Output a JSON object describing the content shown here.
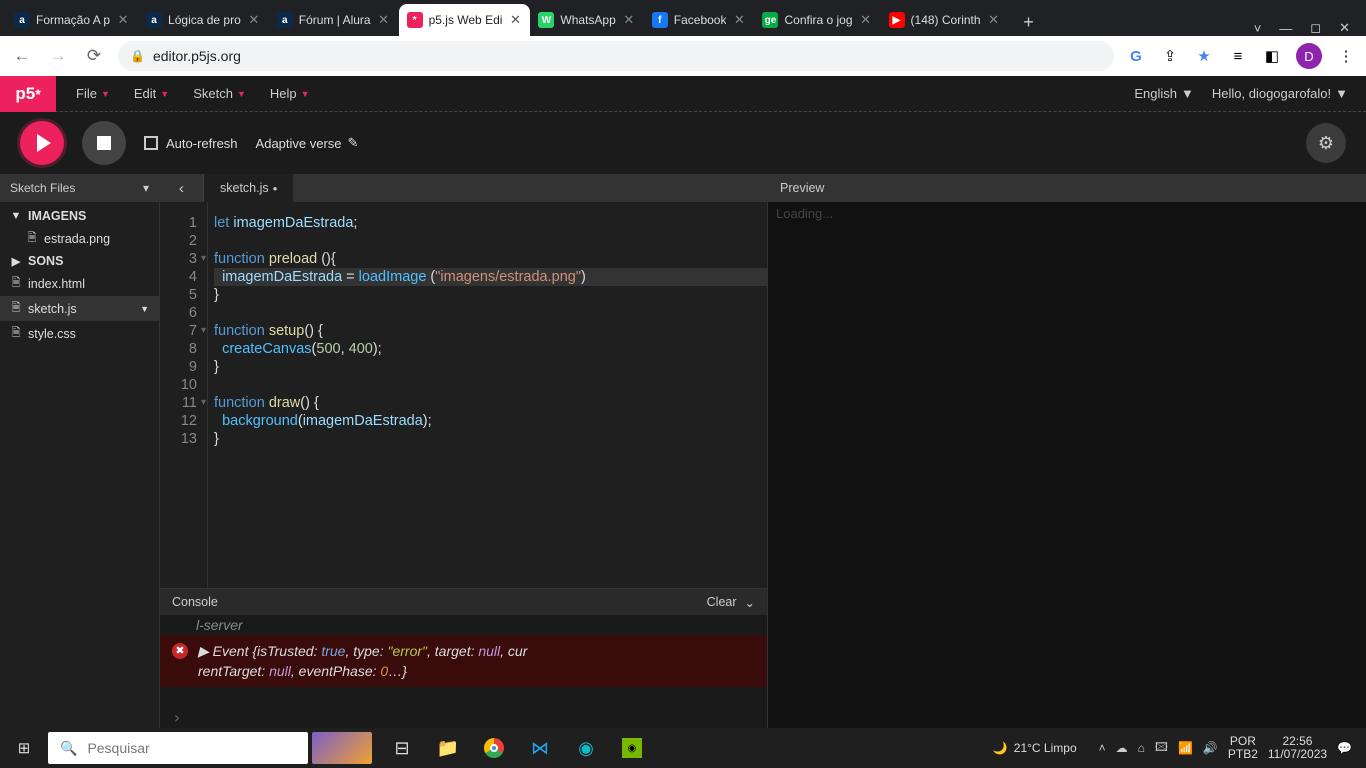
{
  "browser": {
    "tabs": [
      {
        "fav": "a",
        "favbg": "#0b2a4a",
        "label": "Formação A p"
      },
      {
        "fav": "a",
        "favbg": "#0b2a4a",
        "label": "Lógica de pro"
      },
      {
        "fav": "a",
        "favbg": "#0b2a4a",
        "label": "Fórum | Alura"
      },
      {
        "fav": "*",
        "favbg": "#ed225d",
        "label": "p5.js Web Edi",
        "active": true
      },
      {
        "fav": "W",
        "favbg": "#25d366",
        "label": "WhatsApp"
      },
      {
        "fav": "f",
        "favbg": "#1877f2",
        "label": "Facebook"
      },
      {
        "fav": "ge",
        "favbg": "#06aa48",
        "label": "Confira o jog"
      },
      {
        "fav": "▶",
        "favbg": "#ff0000",
        "label": "(148) Corinth"
      }
    ],
    "url": "editor.p5js.org",
    "avatar": "D"
  },
  "p5": {
    "menus": [
      "File",
      "Edit",
      "Sketch",
      "Help"
    ],
    "lang": "English",
    "user_label": "Hello, diogogarofalo!",
    "auto_refresh": "Auto-refresh",
    "sketch_name": "Adaptive verse",
    "sidebar_title": "Sketch Files",
    "files": [
      {
        "type": "folder",
        "open": true,
        "label": "IMAGENS"
      },
      {
        "type": "file",
        "indent": 1,
        "label": "estrada.png"
      },
      {
        "type": "folder",
        "open": false,
        "label": "SONS"
      },
      {
        "type": "file",
        "label": "index.html"
      },
      {
        "type": "file",
        "label": "sketch.js",
        "sel": true
      },
      {
        "type": "file",
        "label": "style.css"
      }
    ],
    "open_tab": "sketch.js",
    "modified_marker": "●",
    "line_numbers": [
      "1",
      "2",
      "3",
      "4",
      "5",
      "6",
      "7",
      "8",
      "9",
      "10",
      "11",
      "12",
      "13"
    ],
    "fold_lines": [
      3,
      7,
      11
    ],
    "highlighted_line": 4,
    "code_tokens": [
      [
        [
          "kw",
          "let "
        ],
        [
          "id",
          "imagemDaEstrada"
        ],
        [
          "pn",
          ";"
        ]
      ],
      [],
      [
        [
          "kw",
          "function "
        ],
        [
          "fn",
          "preload"
        ],
        [
          "pn",
          " (){"
        ]
      ],
      [
        [
          "pn",
          "  "
        ],
        [
          "id",
          "imagemDaEstrada"
        ],
        [
          "pn",
          " = "
        ],
        [
          "call",
          "loadImage"
        ],
        [
          "pn",
          " ("
        ],
        [
          "str",
          "\"imagens/estrada.png\""
        ],
        [
          "pn",
          ")"
        ]
      ],
      [
        [
          "pn",
          "}"
        ]
      ],
      [],
      [
        [
          "kw",
          "function "
        ],
        [
          "fn",
          "setup"
        ],
        [
          "pn",
          "() {"
        ]
      ],
      [
        [
          "pn",
          "  "
        ],
        [
          "call",
          "createCanvas"
        ],
        [
          "pn",
          "("
        ],
        [
          "num",
          "500"
        ],
        [
          "pn",
          ", "
        ],
        [
          "num",
          "400"
        ],
        [
          "pn",
          ");"
        ]
      ],
      [
        [
          "pn",
          "}"
        ]
      ],
      [],
      [
        [
          "kw",
          "function "
        ],
        [
          "fn",
          "draw"
        ],
        [
          "pn",
          "() {"
        ]
      ],
      [
        [
          "pn",
          "  "
        ],
        [
          "call",
          "background"
        ],
        [
          "pn",
          "("
        ],
        [
          "id",
          "imagemDaEstrada"
        ],
        [
          "pn",
          ");"
        ]
      ],
      [
        [
          "pn",
          "}"
        ]
      ]
    ],
    "console_title": "Console",
    "console_clear": "Clear",
    "console_rows": {
      "r1": "l-server",
      "err_pre": "▶ Event {isTrusted: ",
      "err_true": "true",
      "err_s1": ", type: ",
      "err_type": "\"error\"",
      "err_s2": ", target: ",
      "err_null1": "null",
      "err_s3": ", cur",
      "err_line2a": "rentTarget: ",
      "err_null2": "null",
      "err_s4": ", eventPhase: ",
      "err_num": "0",
      "err_end": "…}"
    },
    "preview_title": "Preview",
    "preview_body": "Loading..."
  },
  "taskbar": {
    "search_placeholder": "Pesquisar",
    "weather": "21°C Limpo",
    "lang1": "POR",
    "lang2": "PTB2",
    "time": "22:56",
    "date": "11/07/2023"
  }
}
